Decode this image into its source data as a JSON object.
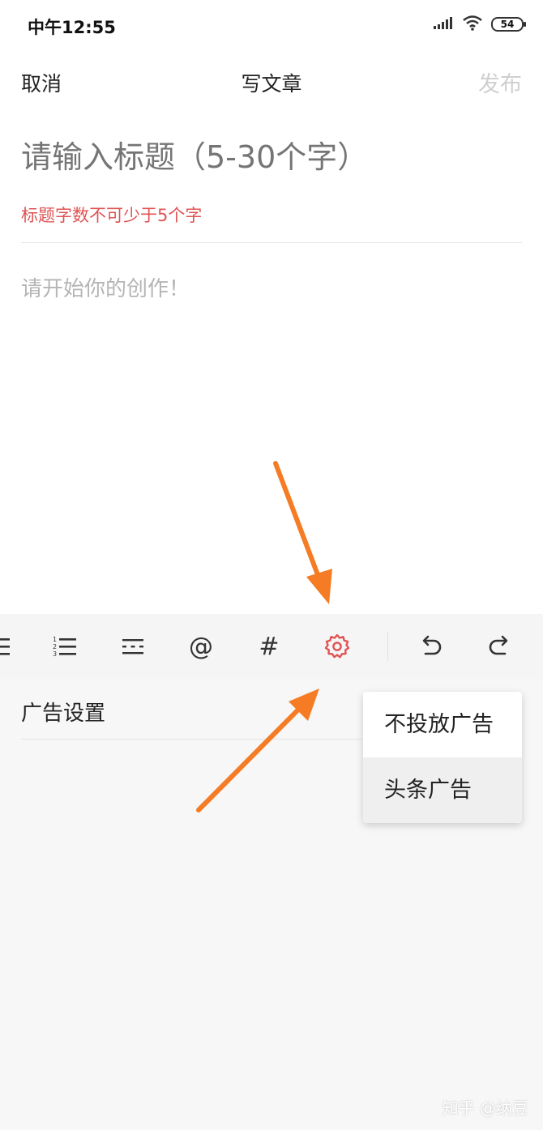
{
  "status_bar": {
    "time": "中午12:55",
    "battery": "54"
  },
  "nav": {
    "cancel_label": "取消",
    "title": "写文章",
    "publish_label": "发布"
  },
  "editor": {
    "title_placeholder": "请输入标题（5-30个字）",
    "title_error": "标题字数不可少于5个字",
    "content_placeholder": "请开始你的创作！"
  },
  "toolbar": {
    "mention_symbol": "@",
    "hashtag_symbol": "#",
    "icons": [
      "align-icon",
      "ordered-list-icon",
      "divider-icon",
      "mention-icon",
      "hashtag-icon",
      "settings-icon",
      "undo-icon",
      "redo-icon"
    ],
    "active_color": "#e05454"
  },
  "ad_settings": {
    "label": "广告设置",
    "options": [
      {
        "label": "不投放广告"
      },
      {
        "label": "头条广告"
      }
    ]
  },
  "watermark": "知乎 @纳豆",
  "annotation_color": "#f57c25"
}
